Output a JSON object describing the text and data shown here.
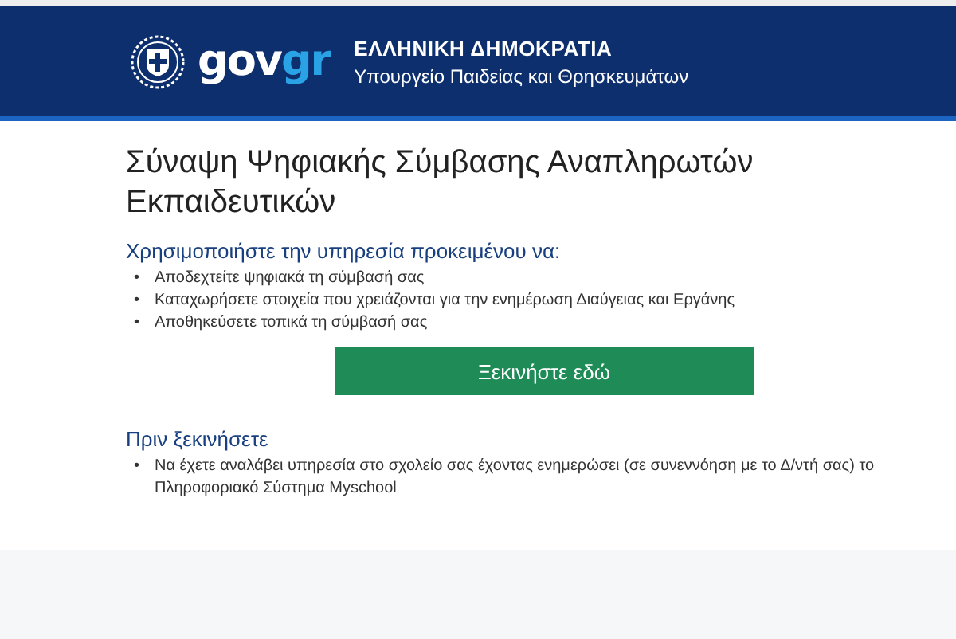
{
  "header": {
    "logo": {
      "main": "gov",
      "accent": "gr"
    },
    "title": "ΕΛΛΗΝΙΚΗ ΔΗΜΟΚΡΑΤΙΑ",
    "subtitle": "Υπουργείο Παιδείας και Θρησκευμάτων"
  },
  "page_title": "Σύναψη Ψηφιακής Σύμβασης Αναπληρωτών Εκπαιδευτικών",
  "usage": {
    "heading": "Χρησιμοποιήστε την υπηρεσία προκειμένου να:",
    "items": [
      {
        "bullet": "•",
        "text": "Αποδεχτείτε ψηφιακά τη σύμβασή σας"
      },
      {
        "bullet": "•",
        "text": "Καταχωρήσετε στοιχεία που χρειάζονται για την ενημέρωση Διαύγειας και Εργάνης"
      },
      {
        "bullet": "•",
        "text": "Αποθηκεύσετε τοπικά τη σύμβασή σας"
      }
    ]
  },
  "start_button": "Ξεκινήστε εδώ",
  "before": {
    "heading": "Πριν ξεκινήσετε",
    "items": [
      {
        "bullet": "•",
        "text": "Να έχετε αναλάβει υπηρεσία στο σχολείο σας έχοντας ενημερώσει (σε συνεννόηση με το Δ/ντή σας) το Πληροφοριακό Σύστημα Myschool"
      }
    ]
  }
}
